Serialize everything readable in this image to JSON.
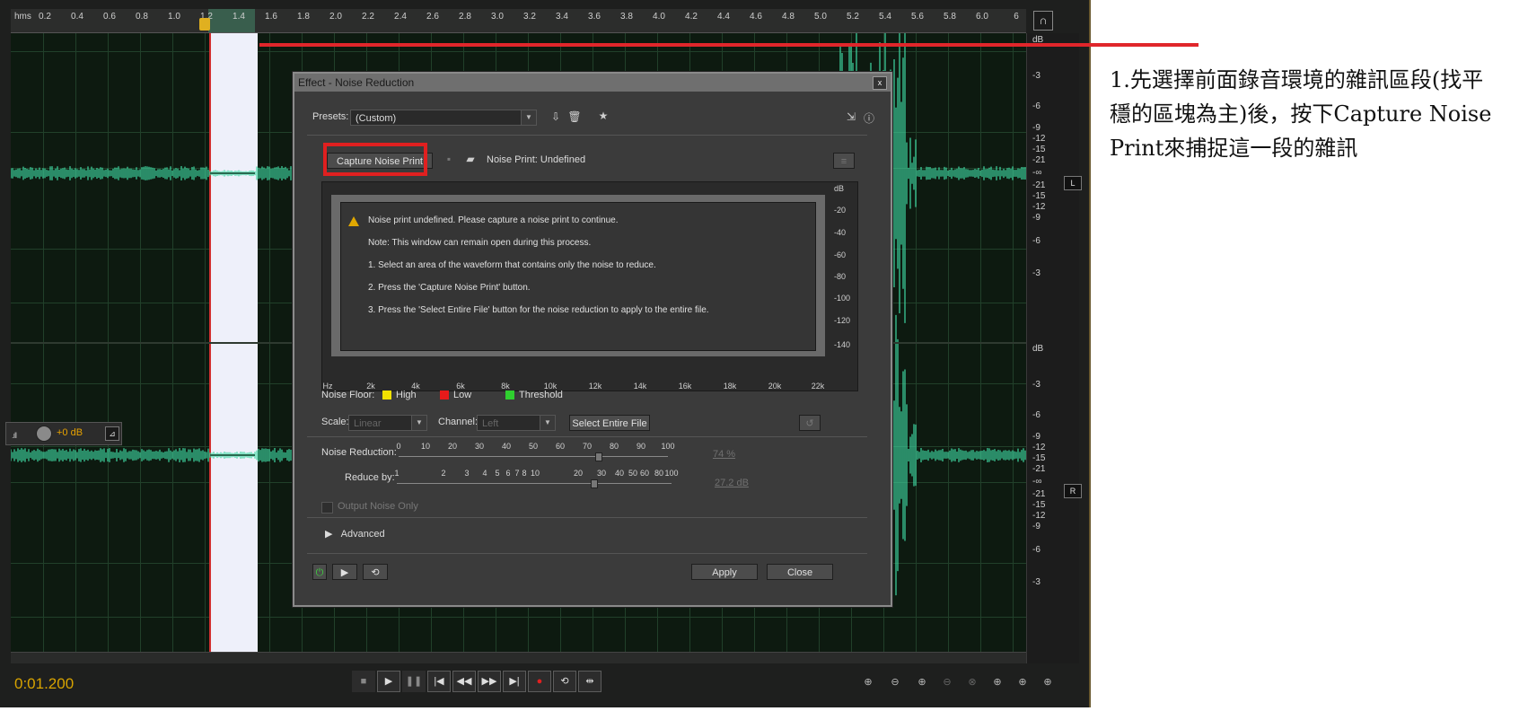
{
  "ruler": {
    "unit": "hms",
    "ticks": [
      "0.2",
      "0.4",
      "0.6",
      "0.8",
      "1.0",
      "1.2",
      "1.4",
      "1.6",
      "1.8",
      "2.0",
      "2.2",
      "2.4",
      "2.6",
      "2.8",
      "3.0",
      "3.2",
      "3.4",
      "3.6",
      "3.8",
      "4.0",
      "4.2",
      "4.4",
      "4.6",
      "4.8",
      "5.0",
      "5.2",
      "5.4",
      "5.6",
      "5.8",
      "6.0",
      "6"
    ]
  },
  "db_scale": {
    "header_top": "dB",
    "header_bottom": "dB",
    "top_labels": [
      "-3",
      "-6",
      "-9",
      "-12",
      "-15",
      "-21",
      "-∞",
      "-21",
      "-15",
      "-12",
      "-9",
      "-6",
      "-3"
    ],
    "bottom_labels": [
      "-3",
      "-6",
      "-9",
      "-12",
      "-15",
      "-21",
      "-∞",
      "-21",
      "-15",
      "-12",
      "-9",
      "-6",
      "-3"
    ],
    "left_channel": "L",
    "right_channel": "R"
  },
  "hud": {
    "volume": "+0 dB"
  },
  "transport": {
    "time": "0:01.200"
  },
  "dialog": {
    "title": "Effect - Noise Reduction",
    "presets_label": "Presets:",
    "preset_value": "(Custom)",
    "capture_button": "Capture Noise Print",
    "noise_print_status": "Noise Print: Undefined",
    "graph": {
      "messages": [
        "Noise print undefined. Please capture a noise print to continue.",
        "Note: This window can remain open during this process.",
        "1. Select an area of the waveform that contains only the noise to reduce.",
        "2. Press the 'Capture Noise Print' button.",
        "3. Press the 'Select Entire File' button for the noise reduction to apply to the entire file."
      ],
      "y_labels": [
        "dB",
        "-20",
        "-40",
        "-60",
        "-80",
        "-100",
        "-120",
        "-140"
      ],
      "x_labels": [
        "Hz",
        "2k",
        "4k",
        "6k",
        "8k",
        "10k",
        "12k",
        "14k",
        "16k",
        "18k",
        "20k",
        "22k"
      ]
    },
    "noise_floor_label": "Noise Floor:",
    "legend": [
      {
        "label": "High",
        "color": "#f2e200"
      },
      {
        "label": "Low",
        "color": "#e81a1a"
      },
      {
        "label": "Threshold",
        "color": "#2fd02f"
      }
    ],
    "scale_label": "Scale:",
    "scale_value": "Linear",
    "channel_label": "Channel:",
    "channel_value": "Left",
    "select_entire_button": "Select Entire File",
    "noise_reduction_label": "Noise Reduction:",
    "noise_reduction_scale": [
      "0",
      "10",
      "20",
      "30",
      "40",
      "50",
      "60",
      "70",
      "80",
      "90",
      "100"
    ],
    "noise_reduction_percent": 74,
    "noise_reduction_value": "74 %",
    "reduce_by_label": "Reduce by:",
    "reduce_by_scale": [
      "1",
      "2",
      "3",
      "4",
      "5",
      "6",
      "7",
      "8",
      "10",
      "20",
      "30",
      "40",
      "50",
      "60",
      "80",
      "100"
    ],
    "reduce_by_db": 27.2,
    "reduce_by_value": "27.2 dB",
    "output_noise_only": "Output Noise Only",
    "advanced": "Advanced",
    "apply_button": "Apply",
    "close_button": "Close"
  },
  "annotation": {
    "text": "1.先選擇前面錄音環境的雜訊區段(找平穩的區塊為主)後，按下Capture Noise Print來捕捉這一段的雜訊",
    "highlight_color": "#e0262b"
  }
}
